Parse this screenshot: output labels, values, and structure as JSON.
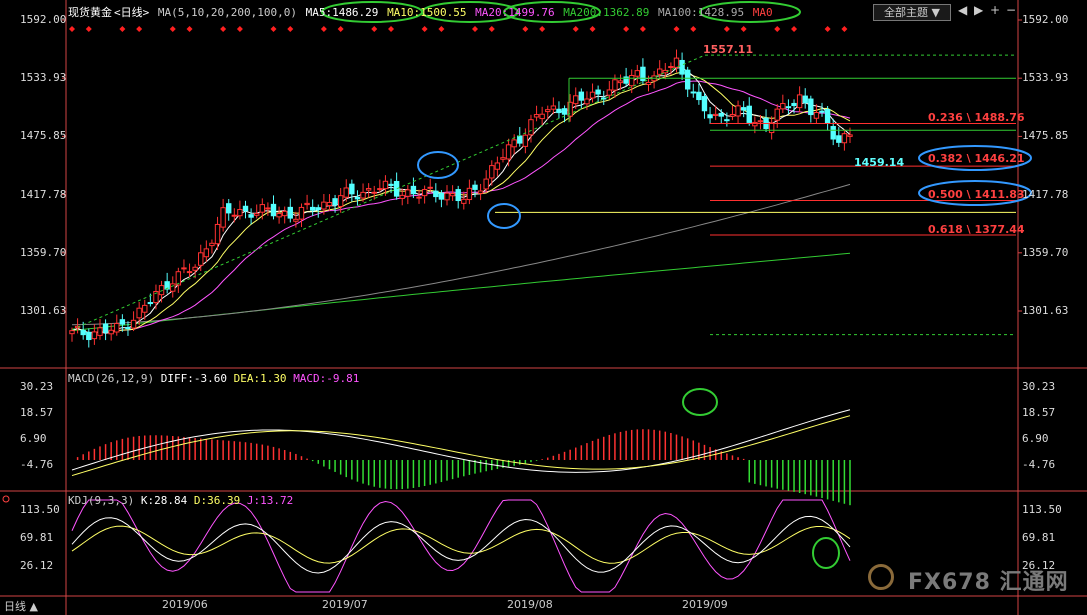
{
  "header": {
    "symbol": "现货黄金",
    "period": "<日线>",
    "ma_params": "MA(5,10,20,200,100,0)",
    "ma5": "MA5:1486.29",
    "ma10": "MA10:1500.55",
    "ma20": "MA20:1499.76",
    "ma200": "MA200:1362.89",
    "ma100": "MA100:1428.95",
    "ma0": "MA0",
    "theme_button": "全部主题 ▼",
    "window_controls": [
      "◀",
      "▶",
      "+",
      "−"
    ]
  },
  "price_axis": [
    "1592.00",
    "1533.93",
    "1475.85",
    "1417.78",
    "1359.70",
    "1301.63"
  ],
  "annotations": {
    "high": "1557.11",
    "low": "1459.14",
    "fib_236": "0.236 \\ 1488.76",
    "fib_382": "0.382 \\ 1446.21",
    "fib_500": "0.500 \\ 1411.83",
    "fib_618": "0.618 \\ 1377.44"
  },
  "macd": {
    "label": "MACD(26,12,9)",
    "diff": "DIFF:-3.60",
    "dea": "DEA:1.30",
    "macd": "MACD:-9.81",
    "axis": [
      "30.23",
      "18.57",
      "6.90",
      "-4.76"
    ]
  },
  "kdj": {
    "label": "KDJ(9,3,3)",
    "k": "K:28.84",
    "d": "D:36.39",
    "j": "J:13.72",
    "axis": [
      "113.50",
      "69.81",
      "26.12"
    ]
  },
  "x_axis": [
    "2019/06",
    "2019/07",
    "2019/08",
    "2019/09"
  ],
  "tab_label": "日线 ▲",
  "watermark": "FX678 汇通网",
  "colors": {
    "up": "#ff3232",
    "down": "#54ffff",
    "ma5": "#ffffff",
    "ma10": "#ffff66",
    "ma20": "#ff55ff",
    "ma200": "#33cc33",
    "ma100": "#888888",
    "fib": "#ff3030",
    "axis": "#d24545"
  }
}
